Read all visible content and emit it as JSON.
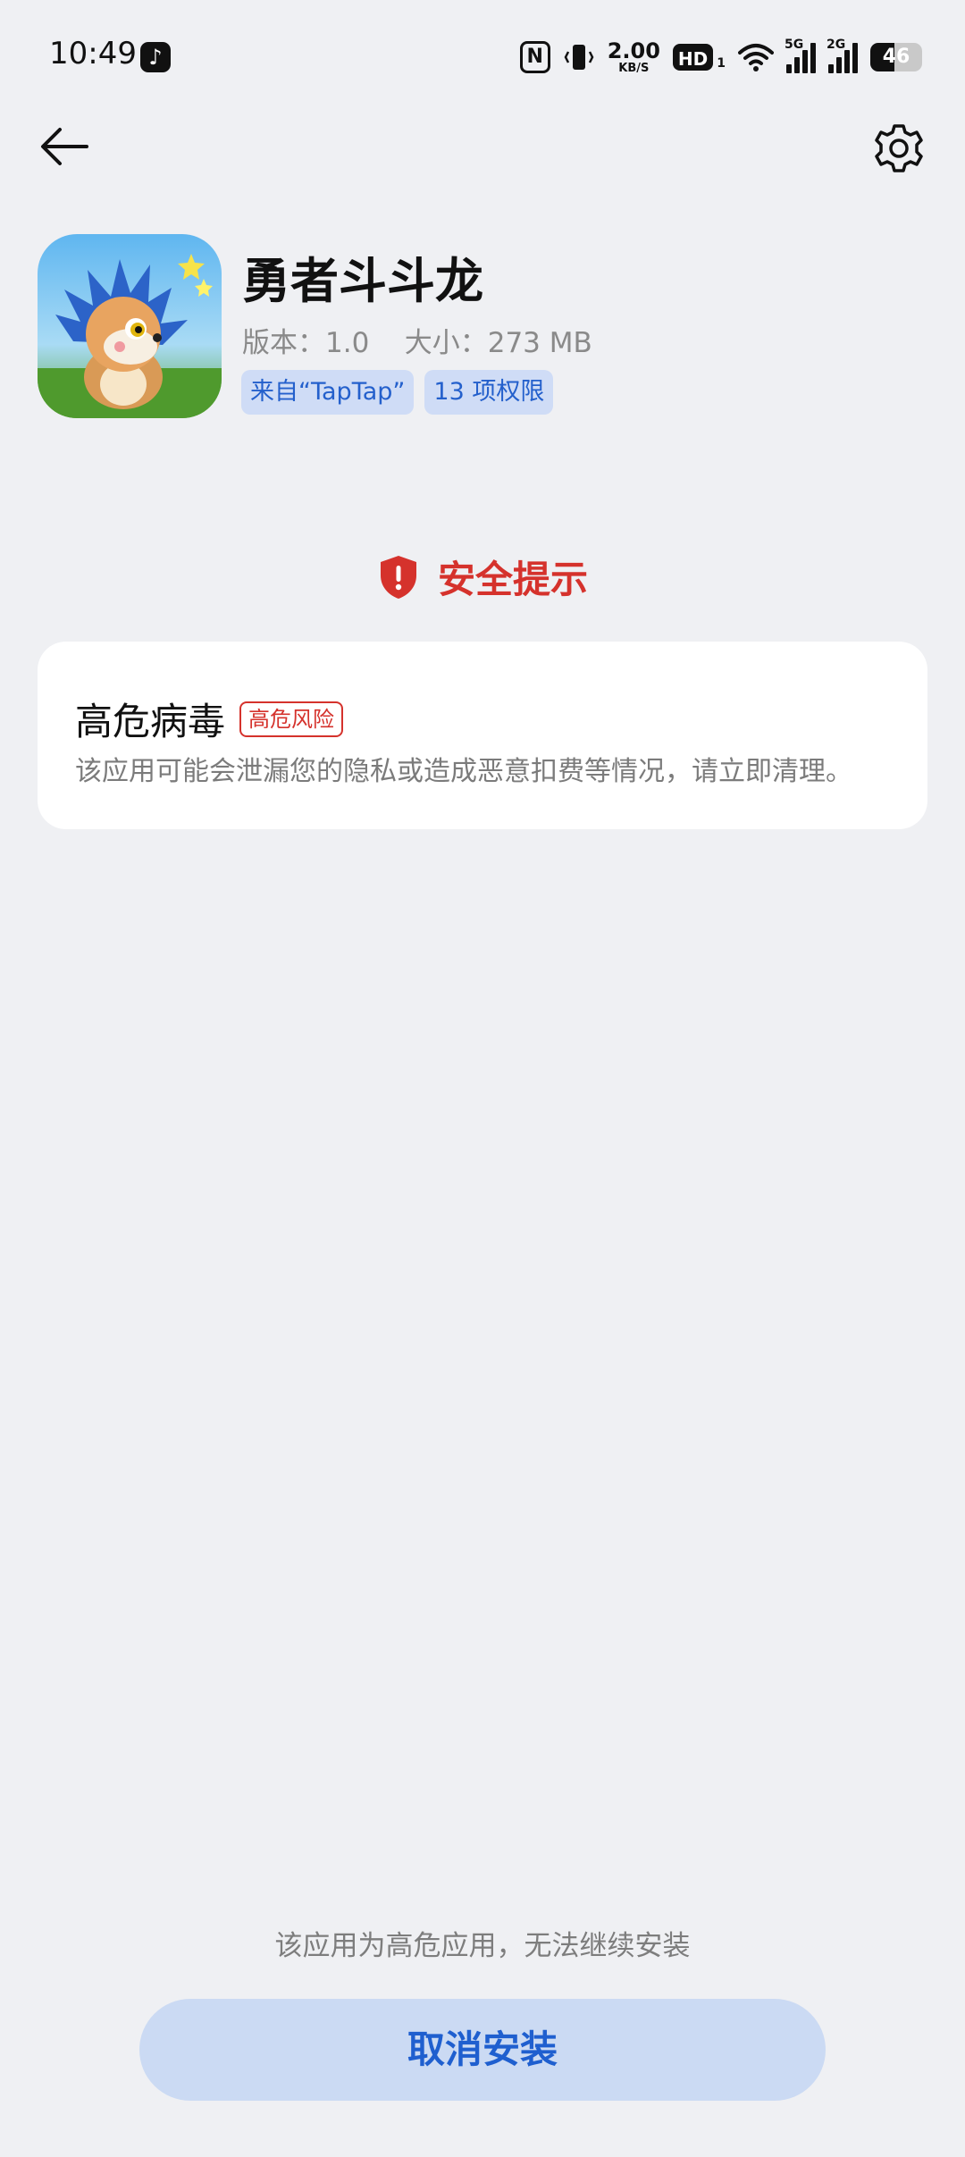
{
  "status_bar": {
    "time": "10:49",
    "network_speed": "2.00",
    "network_speed_unit": "KB/S",
    "hd_label": "HD",
    "hd_sub": "1",
    "signal_1_label": "5G",
    "signal_2_label": "2G",
    "battery_level": "46",
    "icons": [
      "tiktok-icon",
      "nfc-icon",
      "vibrate-icon",
      "wifi-icon",
      "battery-icon"
    ]
  },
  "nav": {
    "back_icon": "arrow-left-icon",
    "settings_icon": "gear-icon"
  },
  "app": {
    "name": "勇者斗斗龙",
    "meta": "版本：1.0    大小：273 MB",
    "tags": [
      "来自“TapTap”",
      "13 项权限"
    ]
  },
  "security": {
    "title": "安全提示",
    "icon": "shield-alert-icon",
    "accent_color": "#d5322c"
  },
  "risk_card": {
    "title": "高危病毒",
    "badge": "高危风险",
    "description": "该应用可能会泄漏您的隐私或造成恶意扣费等情况，请立即清理。"
  },
  "footer": {
    "notice": "该应用为高危应用，无法继续安装",
    "cancel_button": "取消安装",
    "button_color": "#1f5fcf"
  }
}
